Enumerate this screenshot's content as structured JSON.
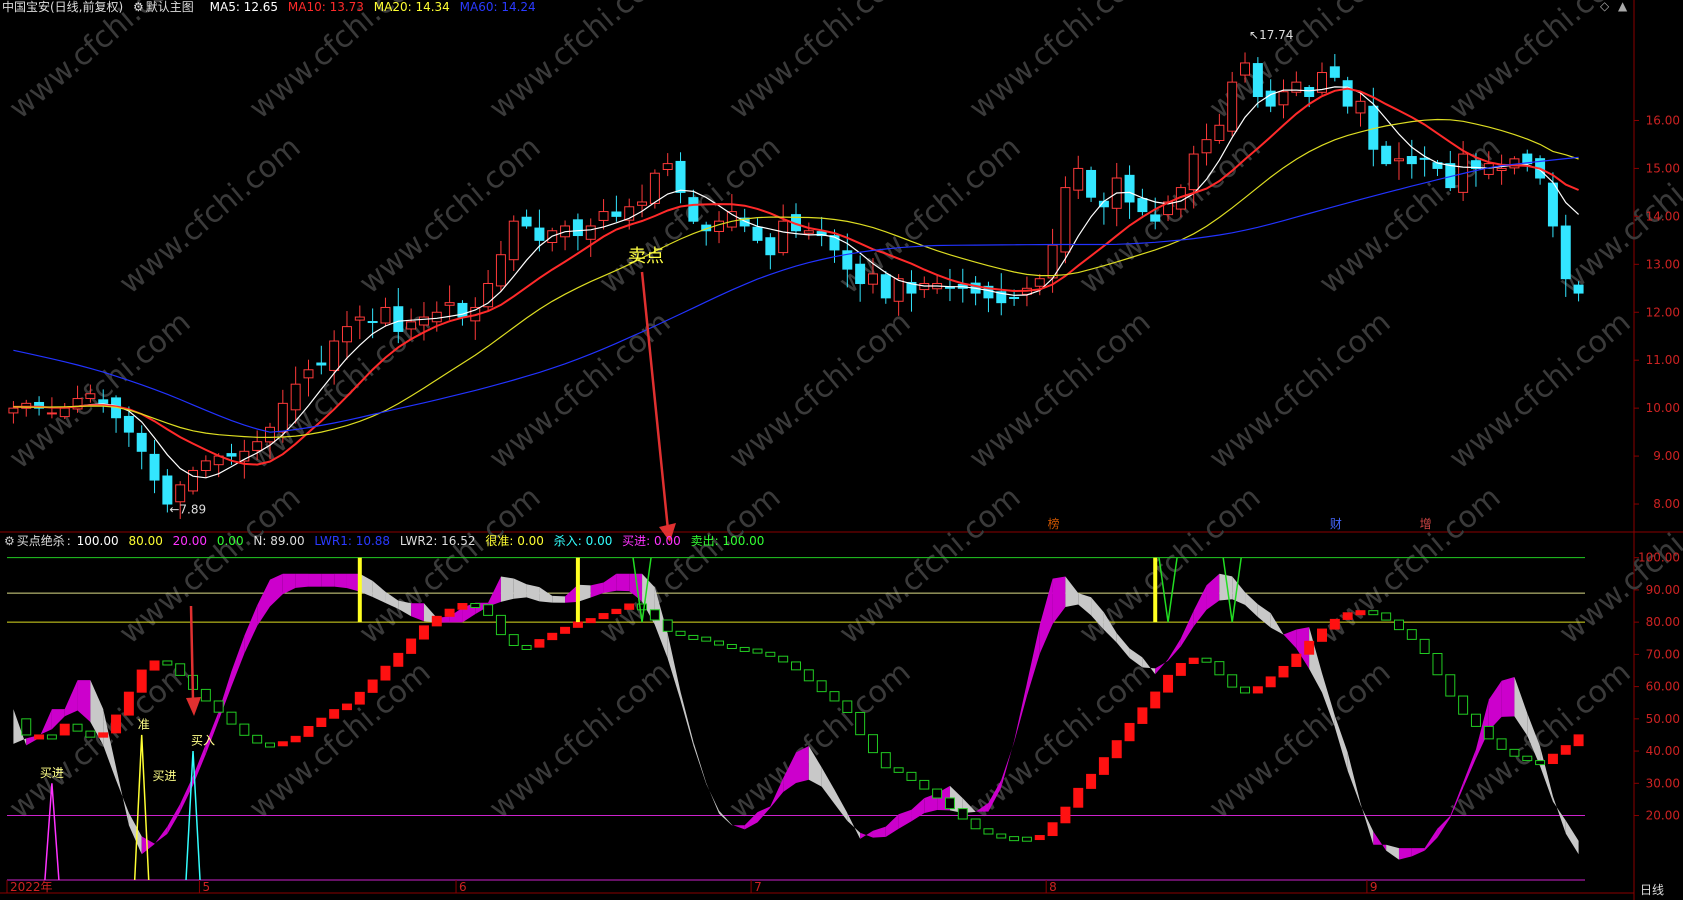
{
  "header": {
    "title": "中国宝安(日线,前复权)",
    "main_label": "默认主图",
    "ma": [
      {
        "label": "MA5: 12.65",
        "color": "#ffffff"
      },
      {
        "label": "MA10: 13.73",
        "color": "#ff2a2a"
      },
      {
        "label": "MA20: 14.34",
        "color": "#ffff33"
      },
      {
        "label": "MA60: 14.24",
        "color": "#2a3aff"
      }
    ]
  },
  "indicator_header": {
    "name": "买点绝杀",
    "values": [
      {
        "label": "100.00",
        "color": "#ffffff"
      },
      {
        "label": "80.00",
        "color": "#ffff33"
      },
      {
        "label": "20.00",
        "color": "#ff33ff"
      },
      {
        "label": "0.00",
        "color": "#33ff33"
      },
      {
        "label": "N: 89.00",
        "color": "#dddddd"
      },
      {
        "label": "LWR1: 10.88",
        "color": "#2a3aff"
      },
      {
        "label": "LWR2: 16.52",
        "color": "#dddddd"
      },
      {
        "label": "很准: 0.00",
        "color": "#ffff33"
      },
      {
        "label": "杀入: 0.00",
        "color": "#33ffff"
      },
      {
        "label": "买进: 0.00",
        "color": "#ff33ff"
      },
      {
        "label": "卖出: 100.00",
        "color": "#33ff33"
      }
    ]
  },
  "labels": {
    "max_price": "17.74",
    "min_price": "7.89",
    "sell_point": "卖点",
    "buy_in_1": "买进",
    "buy_in_2": "买进",
    "accurate": "准",
    "kill_in": "买入",
    "period": "日线",
    "events": [
      "榜",
      "财",
      "增"
    ]
  },
  "chart_data": [
    {
      "type": "candlestick",
      "title": "中国宝安(日线,前复权)",
      "y_axis_ticks": [
        8,
        9,
        10,
        11,
        12,
        13,
        14,
        15,
        16
      ],
      "ylim": [
        7.5,
        18.2
      ],
      "x_ticks": [
        "2022年",
        "5",
        "6",
        "7",
        "8",
        "9"
      ],
      "x_tick_index": [
        0,
        15,
        35,
        58,
        81,
        106
      ],
      "num_bars": 122,
      "ma5_last": 12.65,
      "ma10_last": 13.73,
      "ma20_last": 14.34,
      "ma60_last": 14.24,
      "max_label": 17.74,
      "min_label": 7.89,
      "close_series": [
        10.0,
        10.1,
        10.0,
        9.9,
        10.0,
        10.2,
        10.3,
        10.1,
        9.8,
        9.5,
        9.1,
        8.5,
        8.0,
        8.4,
        8.7,
        8.9,
        9.0,
        9.0,
        9.1,
        9.3,
        9.6,
        10.1,
        10.5,
        10.8,
        10.9,
        11.4,
        11.7,
        11.9,
        11.8,
        12.1,
        11.6,
        11.8,
        11.9,
        12.0,
        12.2,
        11.9,
        12.1,
        12.6,
        13.2,
        13.9,
        13.8,
        13.5,
        13.7,
        13.8,
        13.6,
        13.8,
        14.1,
        14.0,
        14.2,
        14.3,
        14.9,
        15.1,
        14.5,
        13.9,
        13.7,
        13.9,
        14.1,
        13.8,
        13.5,
        13.2,
        13.9,
        13.7,
        13.7,
        13.6,
        13.3,
        12.9,
        12.6,
        12.8,
        12.3,
        12.7,
        12.4,
        12.6,
        12.6,
        12.5,
        12.5,
        12.4,
        12.3,
        12.2,
        12.3,
        12.5,
        12.7,
        13.4,
        14.6,
        15.0,
        14.4,
        14.2,
        14.8,
        14.3,
        14.1,
        13.9,
        14.3,
        14.6,
        15.3,
        15.6,
        15.9,
        16.8,
        17.2,
        16.5,
        16.3,
        16.6,
        16.8,
        16.5,
        17.0,
        16.9,
        16.3,
        16.4,
        15.4,
        15.1,
        15.2,
        15.1,
        15.2,
        15.0,
        14.6,
        15.3,
        15.0,
        15.1,
        15.0,
        15.2,
        15.1,
        14.8,
        13.8,
        12.7,
        12.4
      ]
    },
    {
      "type": "indicator",
      "title": "买点绝杀",
      "y_axis_ticks": [
        20,
        30,
        40,
        50,
        60,
        70,
        80,
        90,
        100
      ],
      "ylim": [
        0,
        103
      ],
      "levels": [
        100,
        89,
        80,
        20,
        0
      ],
      "events": {
        "sell_point_index": 51,
        "buy_arrow_index": 15
      }
    }
  ]
}
